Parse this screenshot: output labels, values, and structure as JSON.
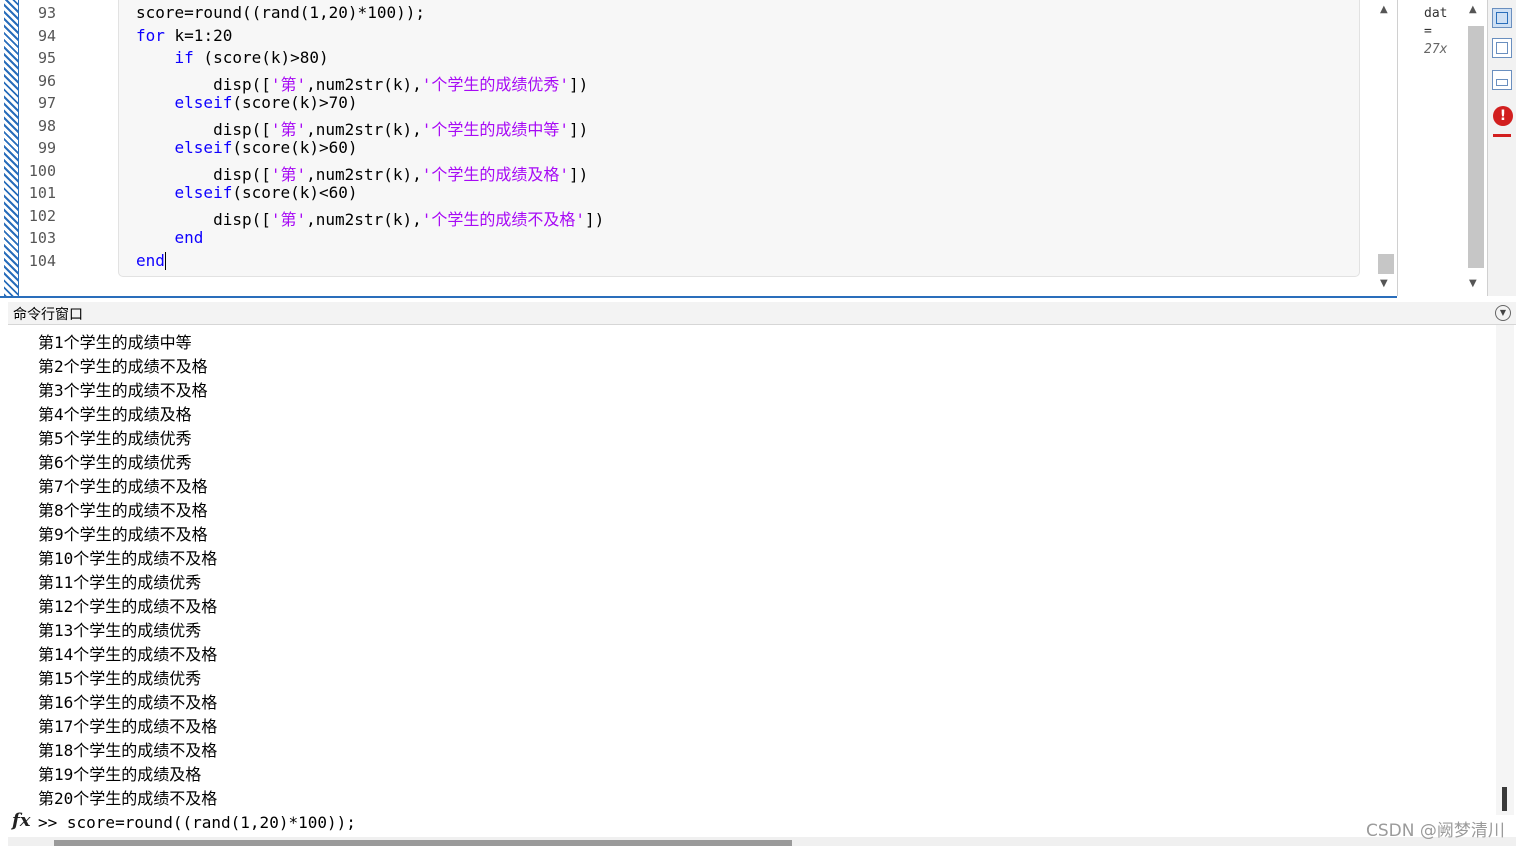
{
  "editor": {
    "line_numbers": [
      "93",
      "94",
      "95",
      "96",
      "97",
      "98",
      "99",
      "100",
      "101",
      "102",
      "103",
      "104"
    ],
    "code_lines": [
      [
        {
          "t": "score=round((rand(1,20)*100));",
          "c": "n"
        }
      ],
      [
        {
          "t": "for",
          "c": "kw"
        },
        {
          "t": " k=1:20",
          "c": "n"
        }
      ],
      [
        {
          "t": "    ",
          "c": "n"
        },
        {
          "t": "if",
          "c": "kw"
        },
        {
          "t": " (score(k)>80)",
          "c": "n"
        }
      ],
      [
        {
          "t": "        disp([",
          "c": "n"
        },
        {
          "t": "'第'",
          "c": "str"
        },
        {
          "t": ",num2str(k),",
          "c": "n"
        },
        {
          "t": "'个学生的成绩优秀'",
          "c": "str"
        },
        {
          "t": "])",
          "c": "n"
        }
      ],
      [
        {
          "t": "    ",
          "c": "n"
        },
        {
          "t": "elseif",
          "c": "kw"
        },
        {
          "t": "(score(k)>70)",
          "c": "n"
        }
      ],
      [
        {
          "t": "        disp([",
          "c": "n"
        },
        {
          "t": "'第'",
          "c": "str"
        },
        {
          "t": ",num2str(k),",
          "c": "n"
        },
        {
          "t": "'个学生的成绩中等'",
          "c": "str"
        },
        {
          "t": "])",
          "c": "n"
        }
      ],
      [
        {
          "t": "    ",
          "c": "n"
        },
        {
          "t": "elseif",
          "c": "kw"
        },
        {
          "t": "(score(k)>60)",
          "c": "n"
        }
      ],
      [
        {
          "t": "        disp([",
          "c": "n"
        },
        {
          "t": "'第'",
          "c": "str"
        },
        {
          "t": ",num2str(k),",
          "c": "n"
        },
        {
          "t": "'个学生的成绩及格'",
          "c": "str"
        },
        {
          "t": "])",
          "c": "n"
        }
      ],
      [
        {
          "t": "    ",
          "c": "n"
        },
        {
          "t": "elseif",
          "c": "kw"
        },
        {
          "t": "(score(k)<60)",
          "c": "n"
        }
      ],
      [
        {
          "t": "        disp([",
          "c": "n"
        },
        {
          "t": "'第'",
          "c": "str"
        },
        {
          "t": ",num2str(k),",
          "c": "n"
        },
        {
          "t": "'个学生的成绩不及格'",
          "c": "str"
        },
        {
          "t": "])",
          "c": "n"
        }
      ],
      [
        {
          "t": "    ",
          "c": "n"
        },
        {
          "t": "end",
          "c": "kw"
        }
      ],
      [
        {
          "t": "end",
          "c": "kw"
        }
      ]
    ],
    "keyword_color": "#0e00ff",
    "string_color": "#a709f5",
    "scroll_position": 0.95
  },
  "workspace": {
    "lines": [
      "dat",
      "=",
      "27x"
    ]
  },
  "toolbar": {
    "icons": [
      "layout-icon",
      "document-icon",
      "panel-icon"
    ],
    "error_symbol": "!",
    "error_color": "#d21f1f"
  },
  "command_window": {
    "title": "命令行窗口",
    "output": [
      "第1个学生的成绩中等",
      "第2个学生的成绩不及格",
      "第3个学生的成绩不及格",
      "第4个学生的成绩及格",
      "第5个学生的成绩优秀",
      "第6个学生的成绩优秀",
      "第7个学生的成绩不及格",
      "第8个学生的成绩不及格",
      "第9个学生的成绩不及格",
      "第10个学生的成绩不及格",
      "第11个学生的成绩优秀",
      "第12个学生的成绩不及格",
      "第13个学生的成绩优秀",
      "第14个学生的成绩不及格",
      "第15个学生的成绩优秀",
      "第16个学生的成绩不及格",
      "第17个学生的成绩不及格",
      "第18个学生的成绩不及格",
      "第19个学生的成绩及格",
      "第20个学生的成绩不及格"
    ],
    "fx_label": "fx",
    "prompt": ">> score=round((rand(1,20)*100));"
  },
  "watermark": "CSDN @阙梦清川"
}
